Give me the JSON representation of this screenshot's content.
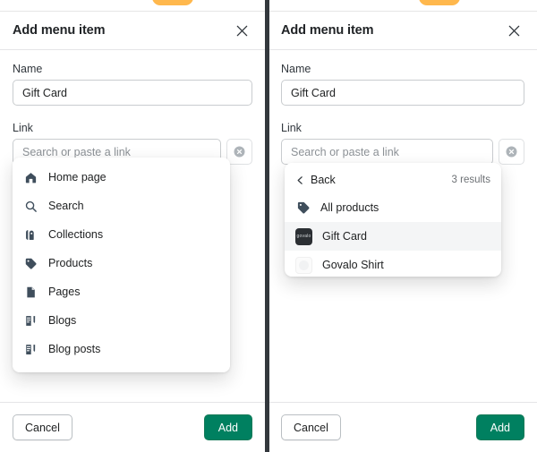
{
  "panels": [
    {
      "id": "left",
      "header": {
        "title": "Add menu item",
        "close_icon": "close-icon"
      },
      "name_field": {
        "label": "Name",
        "value": "Gift Card"
      },
      "link_field": {
        "label": "Link",
        "value": "",
        "placeholder": "Search or paste a link",
        "clear_icon": "circle-x-icon"
      },
      "dropdown": {
        "type": "root-list",
        "items": [
          {
            "label": "Home page",
            "icon": "home-icon"
          },
          {
            "label": "Search",
            "icon": "search-icon"
          },
          {
            "label": "Collections",
            "icon": "collection-icon"
          },
          {
            "label": "Products",
            "icon": "tag-icon"
          },
          {
            "label": "Pages",
            "icon": "page-icon"
          },
          {
            "label": "Blogs",
            "icon": "blog-icon"
          },
          {
            "label": "Blog posts",
            "icon": "blog-post-icon"
          }
        ]
      },
      "footer": {
        "cancel_label": "Cancel",
        "add_label": "Add"
      }
    },
    {
      "id": "right",
      "header": {
        "title": "Add menu item",
        "close_icon": "close-icon"
      },
      "name_field": {
        "label": "Name",
        "value": "Gift Card"
      },
      "link_field": {
        "label": "Link",
        "value": "",
        "placeholder": "Search or paste a link",
        "clear_icon": "circle-x-icon"
      },
      "dropdown": {
        "type": "products-results",
        "back_label": "Back",
        "back_icon": "chevron-left-icon",
        "results_count": "3 results",
        "items": [
          {
            "label": "All products",
            "icon": "tag-icon",
            "thumb": "none"
          },
          {
            "label": "Gift Card",
            "icon": "thumb",
            "thumb": "giftcard",
            "selected": true
          },
          {
            "label": "Govalo Shirt",
            "icon": "thumb",
            "thumb": "shirt"
          }
        ]
      },
      "footer": {
        "cancel_label": "Cancel",
        "add_label": "Add"
      }
    }
  ],
  "colors": {
    "accent_green": "#008060",
    "toast_orange": "#ffb84d",
    "divider_dark": "#33383d",
    "icon_navy": "#3f4e5c"
  }
}
